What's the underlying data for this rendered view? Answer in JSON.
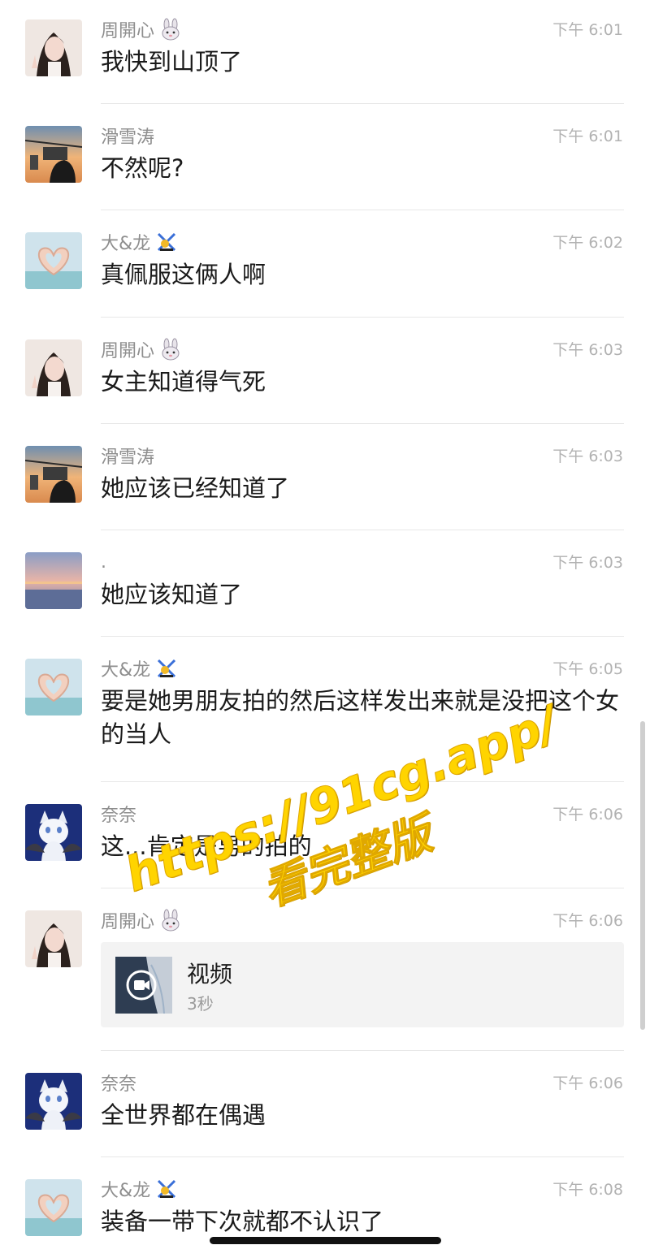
{
  "messages": [
    {
      "sender": "周開心",
      "emoji": "rabbit-icon",
      "time": "下午 6:01",
      "text": "我快到山顶了",
      "avatar": "avatar-girl"
    },
    {
      "sender": "滑雪涛",
      "emoji": "",
      "time": "下午 6:01",
      "text": "不然呢?",
      "avatar": "avatar-cablecar"
    },
    {
      "sender": "大&龙",
      "emoji": "ski-icon",
      "time": "下午 6:02",
      "text": "真佩服这俩人啊",
      "avatar": "avatar-heart-hands"
    },
    {
      "sender": "周開心",
      "emoji": "rabbit-icon",
      "time": "下午 6:03",
      "text": "女主知道得气死",
      "avatar": "avatar-girl"
    },
    {
      "sender": "滑雪涛",
      "emoji": "",
      "time": "下午 6:03",
      "text": "她应该已经知道了",
      "avatar": "avatar-cablecar"
    },
    {
      "sender": ".",
      "emoji": "",
      "time": "下午 6:03",
      "text": "她应该知道了",
      "avatar": "avatar-sunset"
    },
    {
      "sender": "大&龙",
      "emoji": "ski-icon",
      "time": "下午 6:05",
      "text": "要是她男朋友拍的然后这样发出来就是没把这个女的当人",
      "avatar": "avatar-heart-hands"
    },
    {
      "sender": "奈奈",
      "emoji": "",
      "time": "下午 6:06",
      "text": "这...肯定是男的拍的",
      "avatar": "avatar-cat"
    },
    {
      "sender": "周開心",
      "emoji": "rabbit-icon",
      "time": "下午 6:06",
      "text": "",
      "avatar": "avatar-girl",
      "video": {
        "title": "视频",
        "duration": "3秒"
      }
    },
    {
      "sender": "奈奈",
      "emoji": "",
      "time": "下午 6:06",
      "text": "全世界都在偶遇",
      "avatar": "avatar-cat"
    },
    {
      "sender": "大&龙",
      "emoji": "ski-icon",
      "time": "下午 6:08",
      "text": "装备一带下次就都不认识了",
      "avatar": "avatar-heart-hands"
    }
  ],
  "watermark": {
    "line1": "https://91cg.app/",
    "line2": "看完整版"
  }
}
